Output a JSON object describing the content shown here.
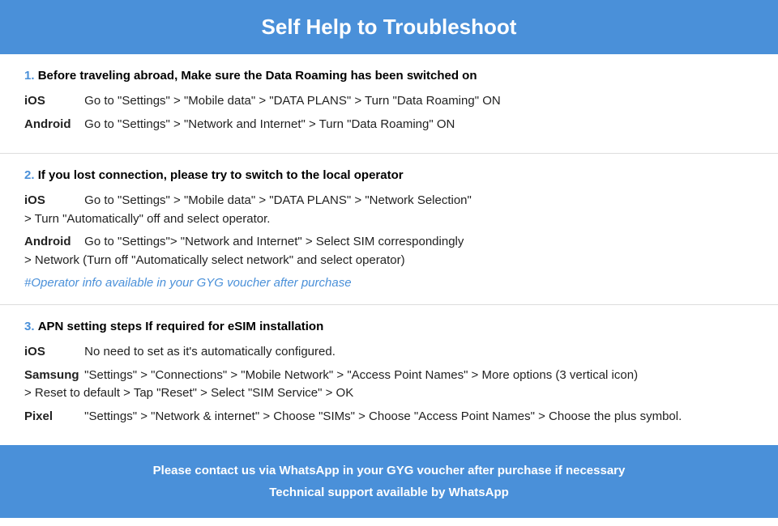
{
  "header": {
    "title": "Self Help to Troubleshoot"
  },
  "sections": [
    {
      "number": "1.",
      "title": "Before traveling abroad, Make sure the Data Roaming has been switched on",
      "rows": [
        {
          "platform": "iOS",
          "text": "Go to \"Settings\" > \"Mobile data\" > \"DATA PLANS\" > Turn \"Data Roaming\" ON"
        },
        {
          "platform": "Android",
          "text": "Go to \"Settings\" > \"Network and Internet\" > Turn \"Data Roaming\" ON"
        }
      ],
      "link": null
    },
    {
      "number": "2.",
      "title": "If you lost connection, please try to switch to the local operator",
      "rows": [
        {
          "platform": "iOS",
          "text": "Go to \"Settings\" > \"Mobile data\" > \"DATA PLANS\" > \"Network Selection\"\n> Turn \"Automatically\" off and select operator."
        },
        {
          "platform": "Android",
          "text": "Go to \"Settings\">  \"Network and Internet\" > Select SIM correspondingly\n> Network (Turn off \"Automatically select network\" and select operator)"
        }
      ],
      "link": "#Operator info available in your GYG voucher after purchase"
    },
    {
      "number": "3.",
      "title": "APN setting steps If required for eSIM installation",
      "rows": [
        {
          "platform": "iOS",
          "text": "No need to set as it's automatically configured."
        },
        {
          "platform": "Samsung",
          "text": "\"Settings\" > \"Connections\" > \"Mobile Network\" > \"Access Point Names\" > More options (3 vertical icon)\n> Reset to default > Tap \"Reset\" > Select \"SIM Service\" > OK"
        },
        {
          "platform": "Pixel",
          "text": "\"Settings\" > \"Network & internet\" > Choose \"SIMs\" > Choose \"Access Point Names\" > Choose the plus symbol."
        }
      ],
      "link": null
    }
  ],
  "footer": {
    "line1": "Please contact us via WhatsApp  in your GYG voucher after purchase if necessary",
    "line2": "Technical support available by WhatsApp"
  }
}
